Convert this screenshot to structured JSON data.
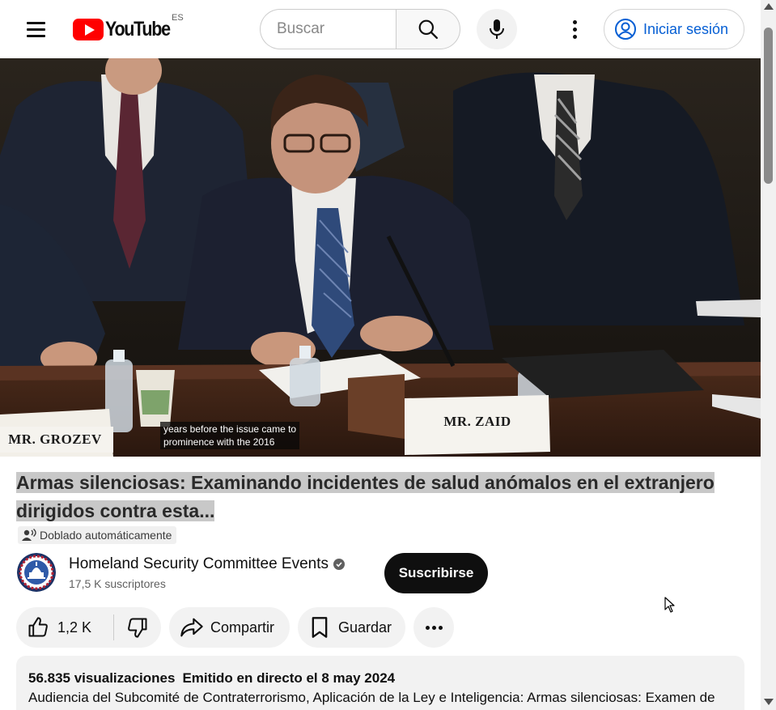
{
  "header": {
    "logo_text": "YouTube",
    "country_code": "ES",
    "search_placeholder": "Buscar",
    "signin_label": "Iniciar sesión"
  },
  "video": {
    "captions": [
      "years before the issue came to",
      "prominence with the 2016"
    ],
    "nameplates": {
      "left": "MR. GROZEV",
      "center": "MR. ZAID"
    }
  },
  "title": "Armas silenciosas: Examinando incidentes de salud anómalos en el extranjero dirigidos contra esta...",
  "dub_label": "Doblado automáticamente",
  "channel": {
    "name": "Homeland Security Committee Events",
    "subscribers": "17,5 K suscriptores",
    "subscribe_label": "Suscribirse"
  },
  "actions": {
    "likes": "1,2 K",
    "share_label": "Compartir",
    "save_label": "Guardar"
  },
  "description": {
    "views": "56.835 visualizaciones",
    "date": "Emitido en directo el 8 may 2024",
    "text": "Audiencia del Subcomité de Contraterrorismo, Aplicación de la Ley e Inteligencia: Armas silenciosas: Examen de"
  },
  "colors": {
    "brand_red": "#ff0000",
    "signin_blue": "#065fd4",
    "subscribe_bg": "#0f0f0f",
    "pill_bg": "#f2f2f2",
    "title_highlight": "#c8c8c8"
  }
}
